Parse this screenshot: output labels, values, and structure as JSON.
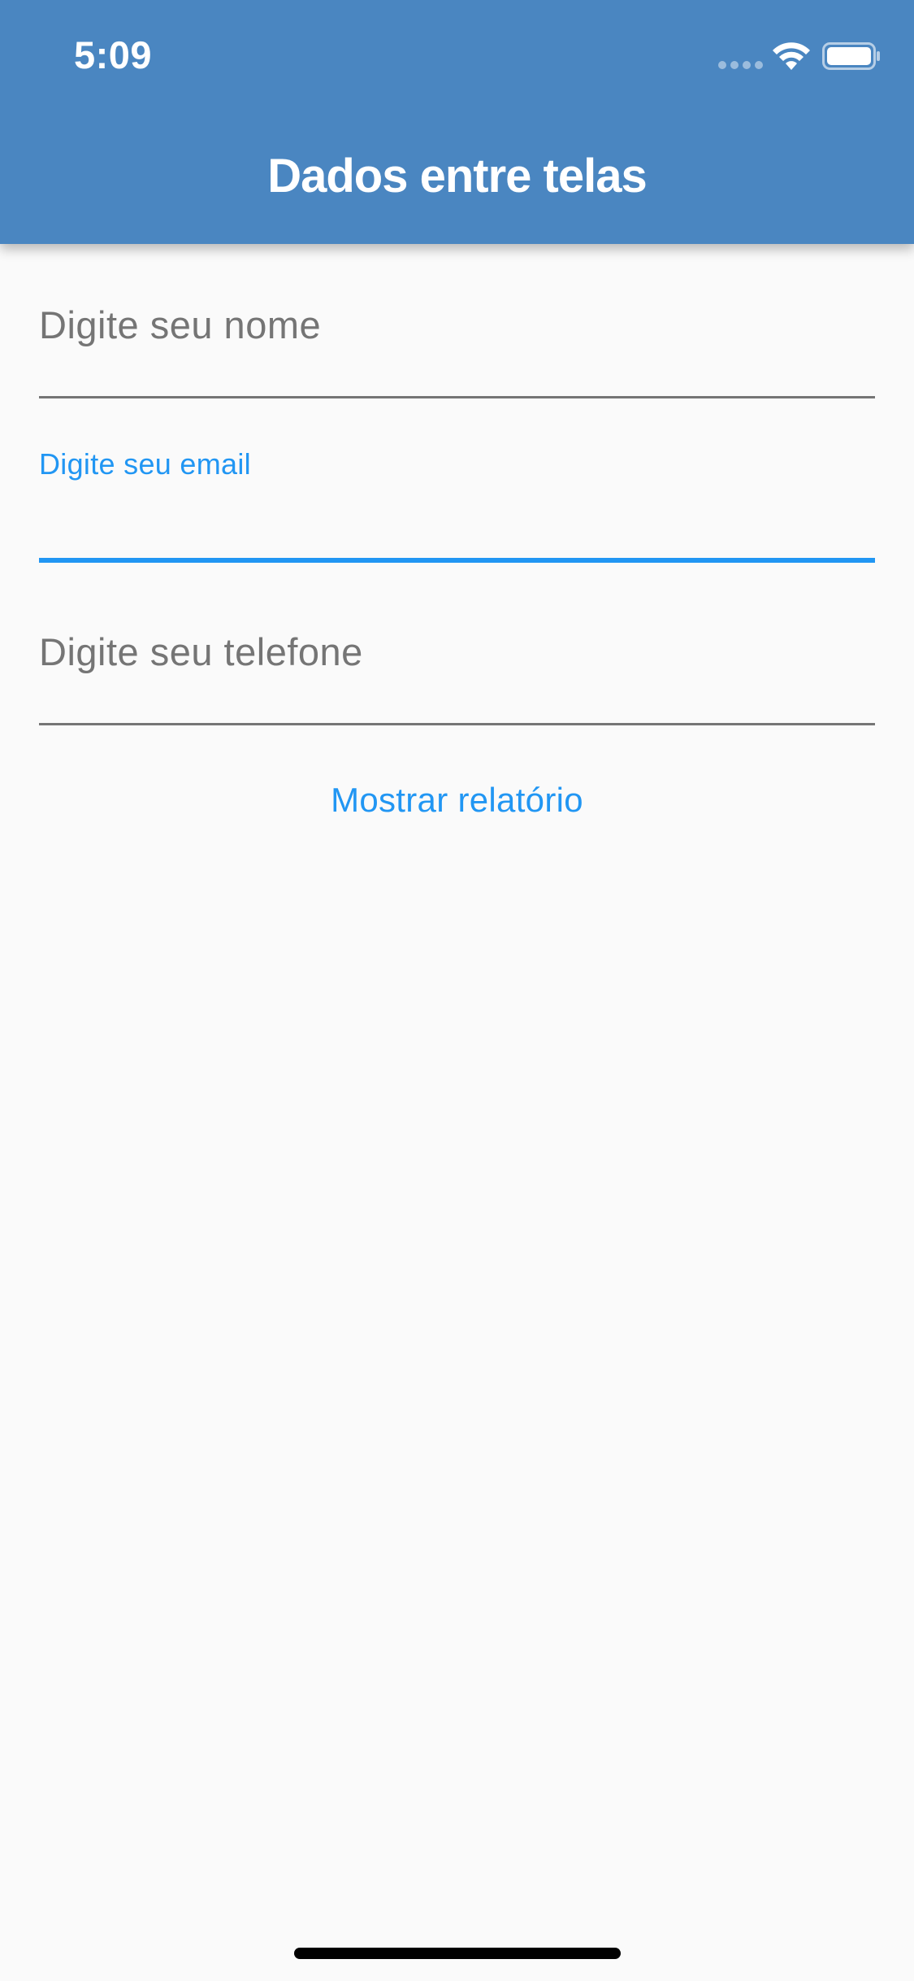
{
  "status_bar": {
    "time": "5:09",
    "wifi_icon": "wifi-icon",
    "battery_icon": "battery-icon"
  },
  "app_bar": {
    "title": "Dados entre telas",
    "color": "#4a86c1"
  },
  "form": {
    "name_field": {
      "placeholder": "Digite seu nome",
      "value": ""
    },
    "email_field": {
      "label": "Digite seu email",
      "value": "",
      "focused": true
    },
    "phone_field": {
      "placeholder": "Digite seu telefone",
      "value": ""
    },
    "submit_label": "Mostrar relatório"
  },
  "colors": {
    "accent": "#2196f3",
    "hint": "#757575",
    "background": "#fafafa"
  }
}
